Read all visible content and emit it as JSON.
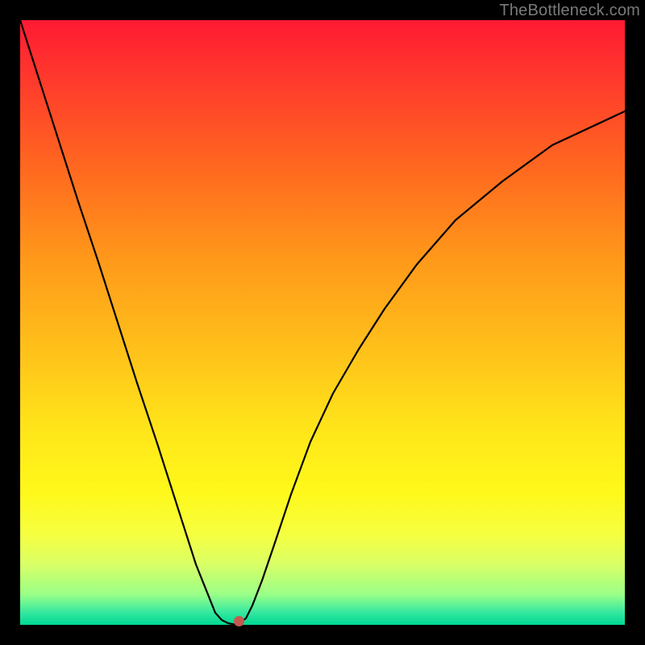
{
  "watermark": "TheBottleneck.com",
  "chart_data": {
    "type": "line",
    "title": "",
    "xlabel": "",
    "ylabel": "",
    "x": [
      0.0,
      0.03,
      0.06,
      0.1,
      0.13,
      0.16,
      0.19,
      0.23,
      0.26,
      0.29,
      0.32,
      0.33,
      0.34,
      0.36,
      0.37,
      0.38,
      0.4,
      0.42,
      0.45,
      0.48,
      0.52,
      0.56,
      0.6,
      0.66,
      0.72,
      0.8,
      0.88,
      1.0
    ],
    "y": [
      1.0,
      0.9,
      0.8,
      0.7,
      0.6,
      0.5,
      0.4,
      0.3,
      0.2,
      0.1,
      0.02,
      0.01,
      0.0,
      0.0,
      0.01,
      0.03,
      0.07,
      0.14,
      0.22,
      0.3,
      0.38,
      0.46,
      0.53,
      0.6,
      0.67,
      0.73,
      0.79,
      0.85
    ],
    "xlim": [
      0,
      1
    ],
    "ylim": [
      0,
      1
    ],
    "marker": {
      "x": 0.362,
      "y": 0.0
    },
    "gradient_stops": [
      {
        "pos": 0.0,
        "color": "#ff1a33"
      },
      {
        "pos": 0.25,
        "color": "#ff6a1f"
      },
      {
        "pos": 0.55,
        "color": "#ffc21a"
      },
      {
        "pos": 0.78,
        "color": "#fff81a"
      },
      {
        "pos": 0.95,
        "color": "#99ff88"
      },
      {
        "pos": 1.0,
        "color": "#00d893"
      }
    ]
  }
}
